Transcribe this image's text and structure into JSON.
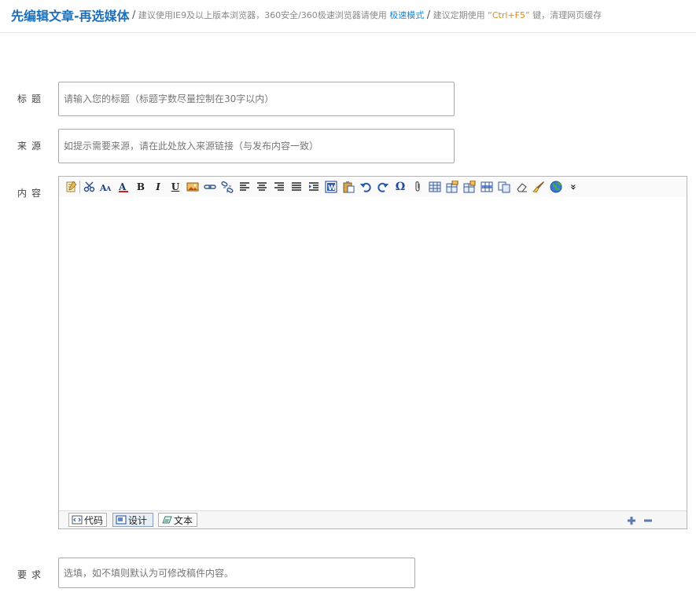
{
  "header": {
    "title": "先编辑文章-再选媒体",
    "separator": "/",
    "tip_prefix": "建议使用IE9及以上版本浏览器，360安全/360极速浏览器请使用",
    "tip_mode": "极速模式",
    "tip_middle": "建议定期使用",
    "tip_key": "“Ctrl+F5”",
    "tip_suffix": "键，清理网页缓存"
  },
  "form": {
    "title_label": "标题",
    "title_placeholder": "请输入您的标题（标题字数尽量控制在30字以内）",
    "source_label": "来源",
    "source_placeholder": "如提示需要来源，请在此处放入来源链接（与发布内容一致）",
    "content_label": "内容",
    "require_label": "要求",
    "require_placeholder": "选填，如不填则默认为可修改稿件内容。"
  },
  "editor": {
    "toolbar_text": {
      "bold": "B",
      "italic": "I",
      "underline": "U",
      "special_char": "Ω",
      "more": "»"
    },
    "modes": [
      {
        "label": "代码",
        "active": false
      },
      {
        "label": "设计",
        "active": true
      },
      {
        "label": "文本",
        "active": false
      }
    ]
  },
  "colors": {
    "title_blue": "#1e6fb8",
    "link_blue": "#1e88d2",
    "key_orange": "#e08a1e",
    "tip_gray": "#8a8a8a"
  }
}
